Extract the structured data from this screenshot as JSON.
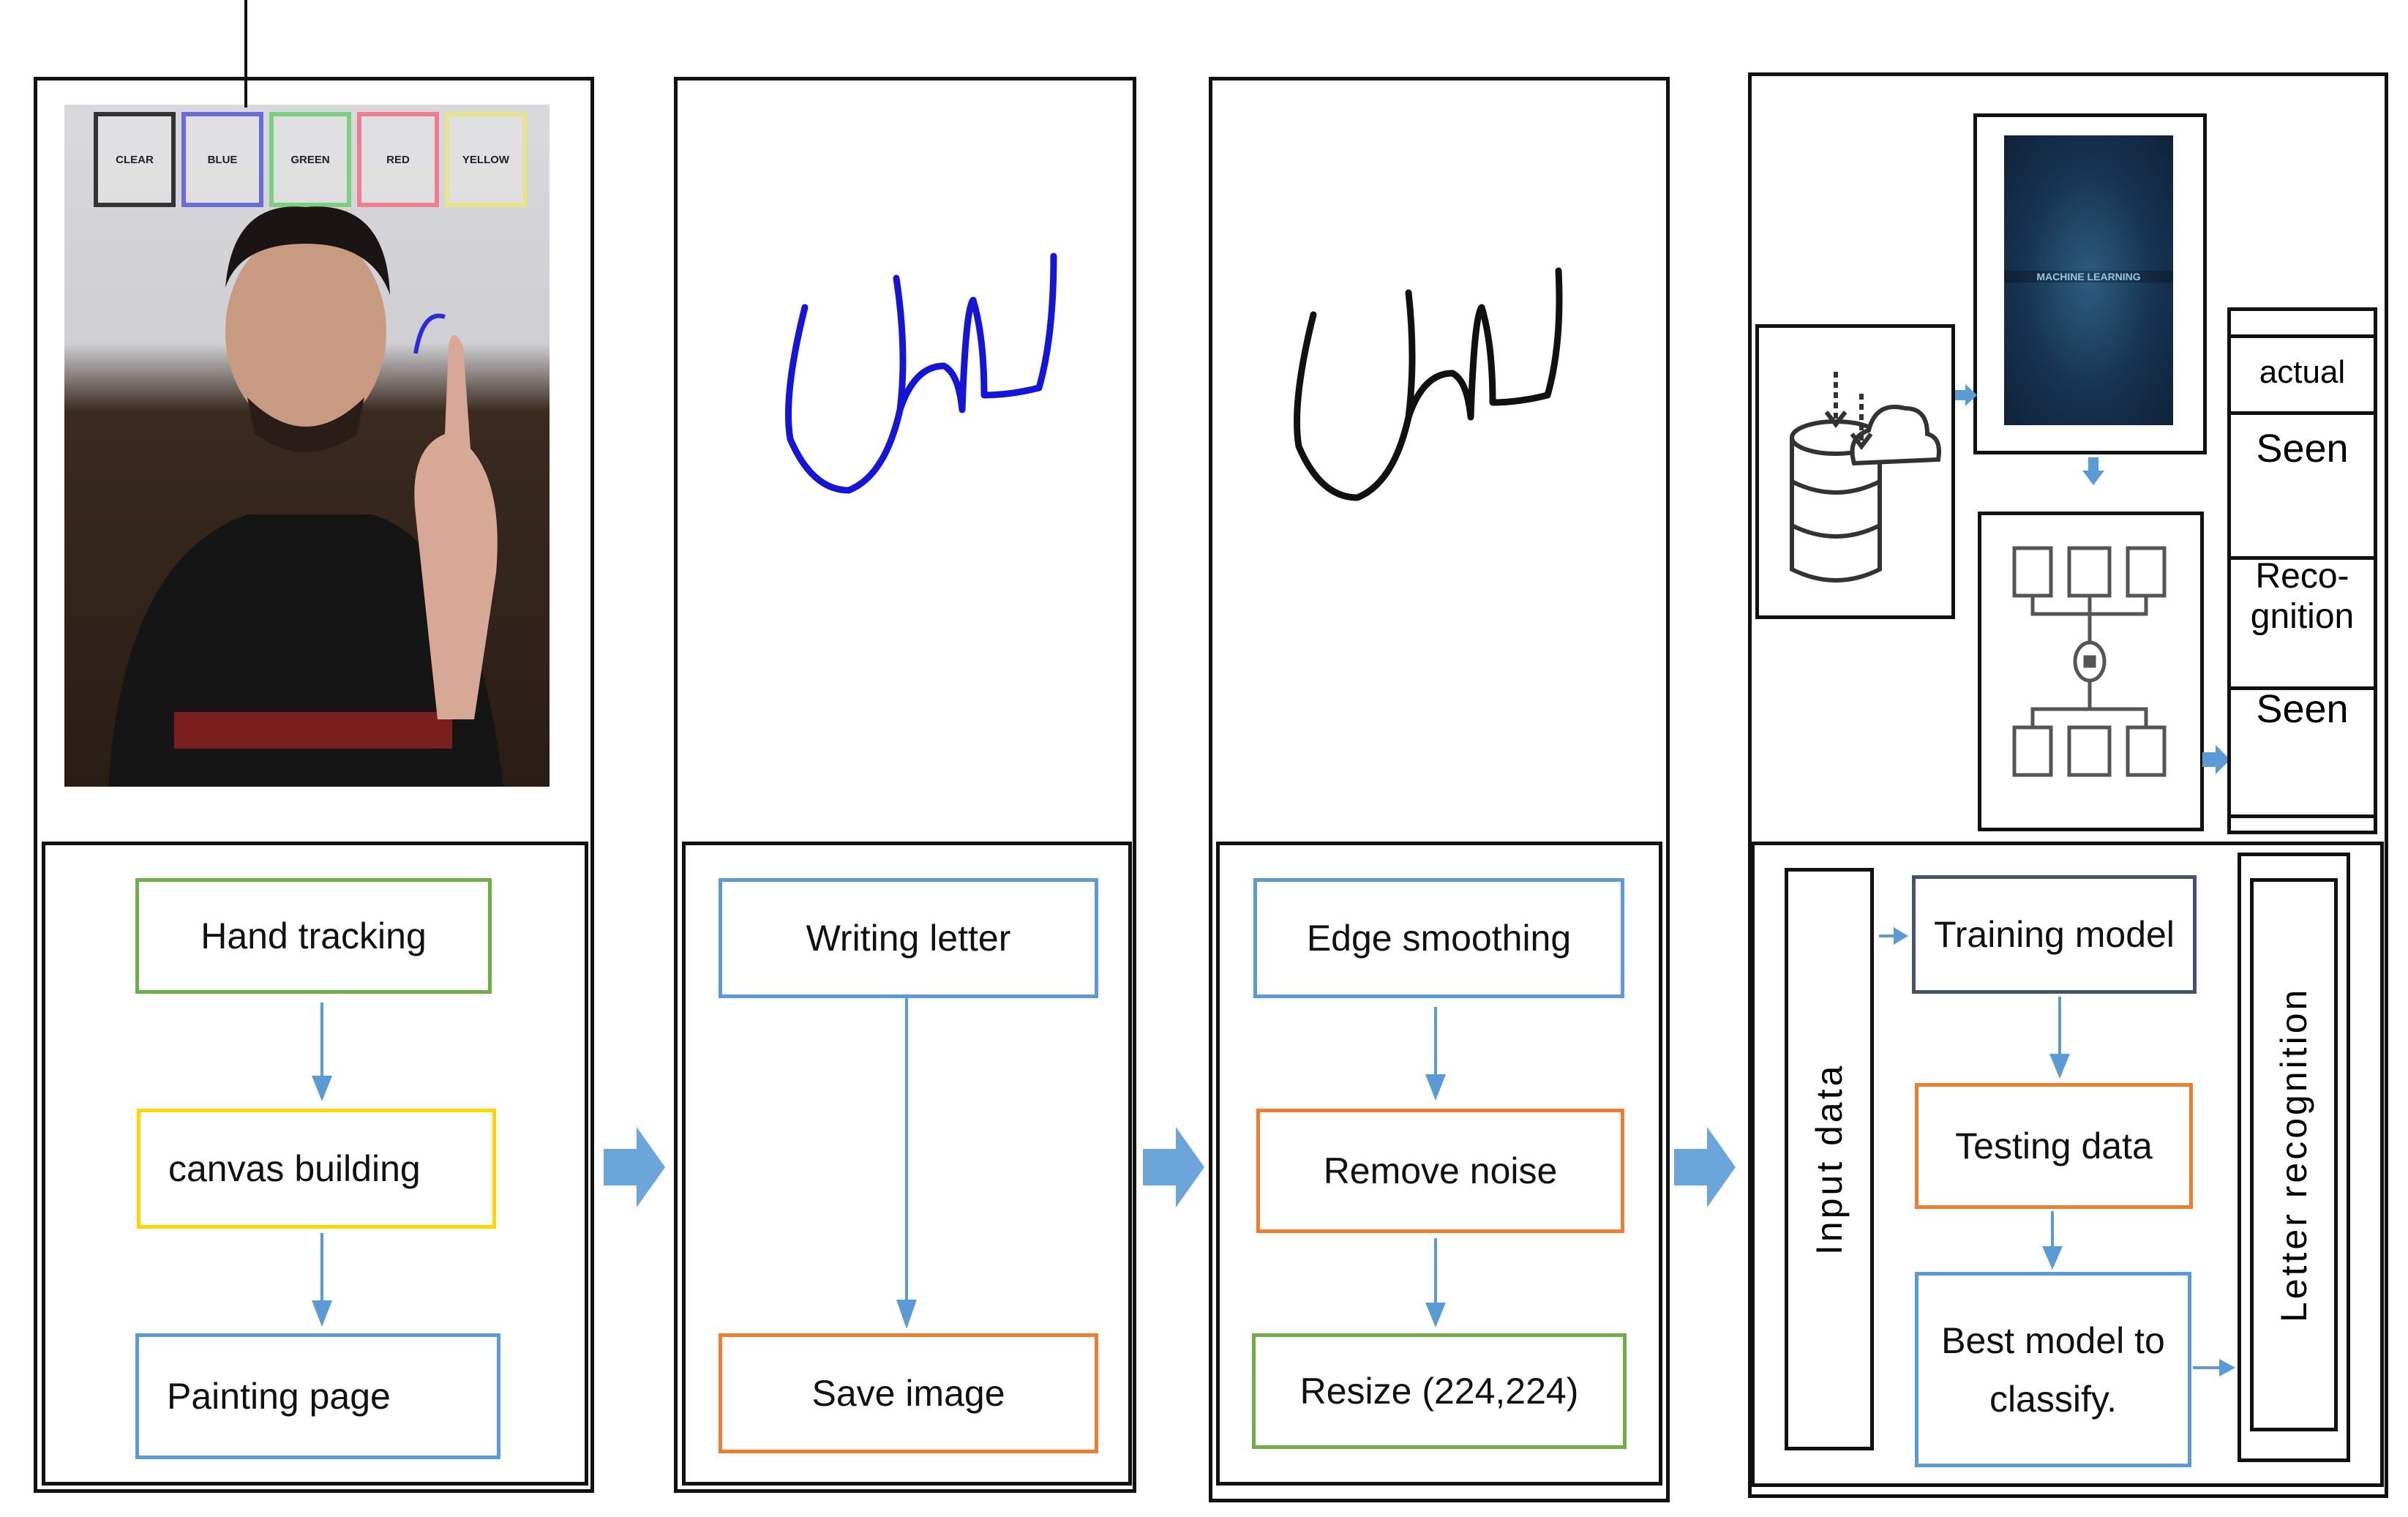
{
  "stage1": {
    "camera_buttons": [
      "CLEAR",
      "BLUE",
      "GREEN",
      "RED",
      "YELLOW"
    ],
    "steps": [
      "Hand tracking",
      "canvas building",
      "Painting page"
    ]
  },
  "stage2": {
    "steps": [
      "Writing letter",
      "Save image"
    ]
  },
  "stage3": {
    "steps": [
      "Edge smoothing",
      "Remove noise",
      "Resize (224,224)"
    ]
  },
  "stage4": {
    "input_label": "Input data",
    "steps": [
      "Training model",
      "Testing data",
      "Best model to classify."
    ],
    "output_label": "Letter recognition",
    "result_table": [
      "actual",
      "Seen",
      "Reco-\ngnition",
      "Seen"
    ],
    "ml_image_caption": "MACHINE LEARNING"
  },
  "colors": {
    "green": "#70ad47",
    "yellow": "#ffd700",
    "blue": "#5b9bd5",
    "orange": "#ed7d31",
    "navy": "#44546a",
    "arrow": "#5b9bd5",
    "stroke_blue": "#1010e0"
  }
}
